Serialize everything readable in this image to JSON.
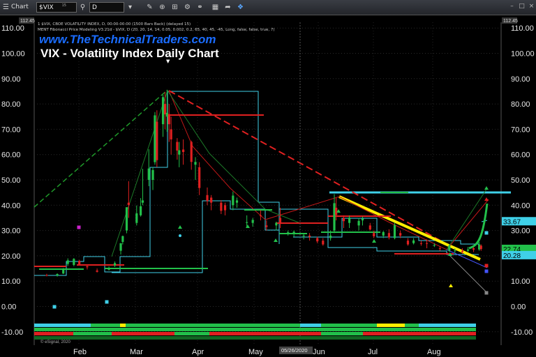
{
  "toolbar": {
    "app_label": "Chart",
    "symbol": "$VIX",
    "symbol_suffix": "15",
    "interval": "D",
    "icons": [
      "menu-icon",
      "search-icon",
      "edit-icon",
      "zoom-icon",
      "layers-icon",
      "settings-icon",
      "calendar-icon",
      "share-icon",
      "twitter-icon",
      "minimize-icon",
      "restore-icon",
      "close-icon"
    ]
  },
  "info_line1": "1 $VIX, CBOE VOLATILITY INDEX, D, 00:00-00:00 (1500 Bars Back) (delayed 15)",
  "info_line2": "MENT Fibonacci Price Modeling V3.21d - $VIX, D (20, 20, 14, 14, 0.05, 0.002, 0.2, 65, 40, 45, -45, Long, false, false, true, 7)",
  "brand": "www.TheTechnicalTraders.com",
  "copyright": "© eSignal, 2020",
  "colors": {
    "up": "#22c04a",
    "down": "#e02020",
    "fib": "#3fd0e8",
    "trend": "#ffee00",
    "dashed_green": "#1f9a2a",
    "dashed_red": "#e02020"
  },
  "chart_data": {
    "type": "candlestick",
    "title": "VIX - Volatility Index Daily Chart",
    "x_labels": [
      "Feb",
      "Mar",
      "Apr",
      "May",
      "Jun",
      "Jul",
      "Aug"
    ],
    "crosshair_date": "05/26/2020",
    "y_ticks": [
      "110.00",
      "100.00",
      "90.00",
      "80.00",
      "70.00",
      "60.00",
      "50.00",
      "40.00",
      "30.00",
      "20.00",
      "10.00",
      "0.00",
      "-10.00"
    ],
    "ylim": [
      -15,
      113
    ],
    "top_value": "112.45",
    "price_flags": [
      {
        "value": "33.67",
        "color": "#3fd0e8"
      },
      {
        "value": "22.74",
        "color": "#22c04a"
      },
      {
        "value": "20.28",
        "color": "#3fd0e8"
      }
    ],
    "ohlc": [
      {
        "d": "Jan 13",
        "o": 12.4,
        "h": 12.9,
        "c": 12.3,
        "l": 11.9
      },
      {
        "d": "Jan 20",
        "o": 12.2,
        "h": 13.1,
        "c": 12.8,
        "l": 11.8
      },
      {
        "d": "Jan 24",
        "o": 13.0,
        "h": 15.2,
        "c": 14.6,
        "l": 12.8
      },
      {
        "d": "Jan 27",
        "o": 16.8,
        "h": 19.0,
        "c": 18.2,
        "l": 16.0
      },
      {
        "d": "Jan 31",
        "o": 16.4,
        "h": 19.1,
        "c": 18.8,
        "l": 15.9
      },
      {
        "d": "Feb 03",
        "o": 18.0,
        "h": 18.4,
        "c": 16.6,
        "l": 16.2
      },
      {
        "d": "Feb 07",
        "o": 15.9,
        "h": 16.5,
        "c": 15.5,
        "l": 14.6
      },
      {
        "d": "Feb 12",
        "o": 14.2,
        "h": 15.0,
        "c": 13.7,
        "l": 13.4
      },
      {
        "d": "Feb 18",
        "o": 14.6,
        "h": 15.8,
        "c": 14.8,
        "l": 14.2
      },
      {
        "d": "Feb 21",
        "o": 16.2,
        "h": 17.8,
        "c": 17.1,
        "l": 15.6
      },
      {
        "d": "Feb 24",
        "o": 22.0,
        "h": 25.0,
        "c": 25.0,
        "l": 20.5
      },
      {
        "d": "Feb 25",
        "o": 25.5,
        "h": 28.0,
        "c": 27.8,
        "l": 24.5
      },
      {
        "d": "Feb 27",
        "o": 30.0,
        "h": 39.2,
        "c": 39.2,
        "l": 28.9
      },
      {
        "d": "Feb 28",
        "o": 41.0,
        "h": 49.5,
        "c": 40.1,
        "l": 35.0
      },
      {
        "d": "Mar 03",
        "o": 33.0,
        "h": 39.9,
        "c": 36.8,
        "l": 32.0
      },
      {
        "d": "Mar 05",
        "o": 36.0,
        "h": 42.8,
        "c": 39.6,
        "l": 35.5
      },
      {
        "d": "Mar 06",
        "o": 41.0,
        "h": 54.4,
        "c": 41.9,
        "l": 40.0
      },
      {
        "d": "Mar 09",
        "o": 50.0,
        "h": 62.1,
        "c": 54.5,
        "l": 47.5
      },
      {
        "d": "Mar 11",
        "o": 50.0,
        "h": 55.0,
        "c": 53.9,
        "l": 46.0
      },
      {
        "d": "Mar 12",
        "o": 57.0,
        "h": 76.8,
        "c": 75.5,
        "l": 56.0
      },
      {
        "d": "Mar 13",
        "o": 73.0,
        "h": 77.5,
        "c": 57.8,
        "l": 55.0
      },
      {
        "d": "Mar 16",
        "o": 72.0,
        "h": 83.6,
        "c": 82.7,
        "l": 67.0
      },
      {
        "d": "Mar 17",
        "o": 80.0,
        "h": 84.8,
        "c": 75.9,
        "l": 70.0
      },
      {
        "d": "Mar 18",
        "o": 75.0,
        "h": 85.5,
        "c": 76.5,
        "l": 69.0
      },
      {
        "d": "Mar 19",
        "o": 76.0,
        "h": 80.0,
        "c": 72.0,
        "l": 65.0
      },
      {
        "d": "Mar 20",
        "o": 70.0,
        "h": 75.0,
        "c": 66.0,
        "l": 60.0
      },
      {
        "d": "Mar 23",
        "o": 65.0,
        "h": 66.5,
        "c": 61.6,
        "l": 58.0
      },
      {
        "d": "Mar 24",
        "o": 60.0,
        "h": 65.0,
        "c": 61.7,
        "l": 55.0
      },
      {
        "d": "Mar 26",
        "o": 62.0,
        "h": 66.0,
        "c": 61.0,
        "l": 56.0
      },
      {
        "d": "Mar 30",
        "o": 65.0,
        "h": 65.5,
        "c": 57.1,
        "l": 54.0
      },
      {
        "d": "Apr 01",
        "o": 56.0,
        "h": 59.0,
        "c": 57.1,
        "l": 50.0
      },
      {
        "d": "Apr 03",
        "o": 55.0,
        "h": 57.0,
        "c": 46.8,
        "l": 44.0
      },
      {
        "d": "Apr 07",
        "o": 44.0,
        "h": 47.0,
        "c": 41.7,
        "l": 40.0
      },
      {
        "d": "Apr 09",
        "o": 43.0,
        "h": 44.0,
        "c": 41.0,
        "l": 38.0
      },
      {
        "d": "Apr 14",
        "o": 41.0,
        "h": 42.0,
        "c": 37.8,
        "l": 36.5
      },
      {
        "d": "Apr 16",
        "o": 40.0,
        "h": 41.0,
        "c": 38.0,
        "l": 36.0
      },
      {
        "d": "Apr 20",
        "o": 40.0,
        "h": 45.4,
        "c": 43.8,
        "l": 38.0
      },
      {
        "d": "Apr 22",
        "o": 41.0,
        "h": 43.0,
        "c": 41.9,
        "l": 39.0
      },
      {
        "d": "Apr 27",
        "o": 33.0,
        "h": 36.0,
        "c": 33.3,
        "l": 31.0
      },
      {
        "d": "Apr 30",
        "o": 33.0,
        "h": 35.0,
        "c": 34.2,
        "l": 31.5
      },
      {
        "d": "May 04",
        "o": 36.0,
        "h": 38.0,
        "c": 35.9,
        "l": 34.0
      },
      {
        "d": "May 07",
        "o": 32.0,
        "h": 34.0,
        "c": 31.4,
        "l": 30.0
      },
      {
        "d": "May 12",
        "o": 32.0,
        "h": 33.5,
        "c": 33.0,
        "l": 30.0
      },
      {
        "d": "May 14",
        "o": 35.0,
        "h": 39.0,
        "c": 32.6,
        "l": 31.0
      },
      {
        "d": "May 18",
        "o": 29.0,
        "h": 30.0,
        "c": 29.3,
        "l": 28.0
      },
      {
        "d": "May 21",
        "o": 29.0,
        "h": 30.0,
        "c": 29.5,
        "l": 27.5
      },
      {
        "d": "May 26",
        "o": 28.0,
        "h": 29.0,
        "c": 28.0,
        "l": 26.5
      },
      {
        "d": "May 29",
        "o": 28.0,
        "h": 29.0,
        "c": 27.5,
        "l": 26.0
      },
      {
        "d": "Jun 02",
        "o": 27.0,
        "h": 27.6,
        "c": 25.7,
        "l": 25.0
      },
      {
        "d": "Jun 05",
        "o": 26.0,
        "h": 27.0,
        "c": 24.5,
        "l": 24.0
      },
      {
        "d": "Jun 09",
        "o": 27.0,
        "h": 30.0,
        "c": 28.0,
        "l": 26.0
      },
      {
        "d": "Jun 11",
        "o": 30.0,
        "h": 44.4,
        "c": 40.8,
        "l": 29.0
      },
      {
        "d": "Jun 12",
        "o": 39.0,
        "h": 43.0,
        "c": 36.1,
        "l": 34.0
      },
      {
        "d": "Jun 16",
        "o": 35.0,
        "h": 36.0,
        "c": 33.7,
        "l": 31.0
      },
      {
        "d": "Jun 19",
        "o": 33.0,
        "h": 36.0,
        "c": 35.1,
        "l": 31.0
      },
      {
        "d": "Jun 24",
        "o": 32.0,
        "h": 35.0,
        "c": 33.8,
        "l": 30.0
      },
      {
        "d": "Jun 26",
        "o": 34.0,
        "h": 35.5,
        "c": 34.7,
        "l": 32.0
      },
      {
        "d": "Jun 30",
        "o": 32.0,
        "h": 33.0,
        "c": 30.4,
        "l": 30.0
      },
      {
        "d": "Jul 02",
        "o": 29.0,
        "h": 30.0,
        "c": 27.7,
        "l": 27.0
      },
      {
        "d": "Jul 07",
        "o": 28.0,
        "h": 29.8,
        "c": 29.4,
        "l": 27.0
      },
      {
        "d": "Jul 10",
        "o": 29.0,
        "h": 30.5,
        "c": 27.3,
        "l": 26.5
      },
      {
        "d": "Jul 13",
        "o": 27.0,
        "h": 33.0,
        "c": 32.2,
        "l": 26.5
      },
      {
        "d": "Jul 16",
        "o": 29.0,
        "h": 30.0,
        "c": 28.0,
        "l": 27.0
      },
      {
        "d": "Jul 20",
        "o": 26.0,
        "h": 27.0,
        "c": 24.5,
        "l": 24.0
      },
      {
        "d": "Jul 23",
        "o": 25.0,
        "h": 27.0,
        "c": 26.1,
        "l": 24.5
      },
      {
        "d": "Jul 27",
        "o": 25.0,
        "h": 26.0,
        "c": 24.7,
        "l": 24.0
      },
      {
        "d": "Jul 30",
        "o": 25.0,
        "h": 26.5,
        "c": 24.8,
        "l": 23.0
      },
      {
        "d": "Aug 03",
        "o": 24.0,
        "h": 25.0,
        "c": 24.3,
        "l": 23.5
      },
      {
        "d": "Aug 06",
        "o": 23.0,
        "h": 23.8,
        "c": 22.7,
        "l": 22.0
      },
      {
        "d": "Aug 11",
        "o": 22.0,
        "h": 24.5,
        "c": 24.0,
        "l": 21.5
      },
      {
        "d": "Aug 14",
        "o": 22.0,
        "h": 23.0,
        "c": 22.1,
        "l": 21.0
      },
      {
        "d": "Aug 18",
        "o": 22.0,
        "h": 23.0,
        "c": 21.5,
        "l": 20.8
      },
      {
        "d": "Aug 21",
        "o": 22.0,
        "h": 23.5,
        "c": 22.5,
        "l": 21.5
      },
      {
        "d": "Aug 24",
        "o": 23.0,
        "h": 23.5,
        "c": 22.4,
        "l": 21.5
      },
      {
        "d": "Aug 27",
        "o": 22.5,
        "h": 25.5,
        "c": 24.5,
        "l": 22.0
      },
      {
        "d": "Aug 28",
        "o": 24.0,
        "h": 24.5,
        "c": 22.7,
        "l": 22.0
      }
    ]
  }
}
